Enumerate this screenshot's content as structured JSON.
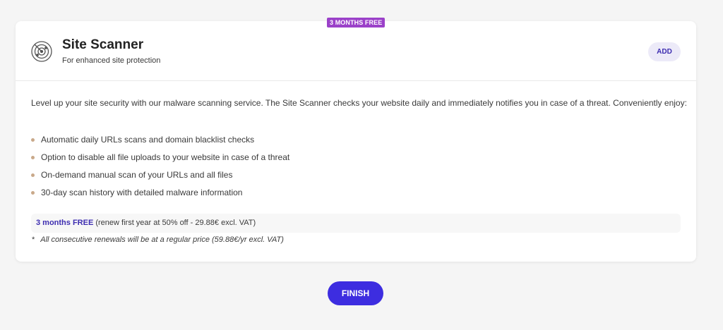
{
  "badge": "3 MONTHS FREE",
  "product": {
    "icon": "radar-icon",
    "title": "Site Scanner",
    "subtitle": "For enhanced site protection",
    "add_label": "ADD"
  },
  "description": "Level up your site security with our malware scanning service. The Site Scanner checks your website daily and immediately notifies you in case of a threat. Conveniently enjoy:",
  "features": [
    "Automatic daily URLs scans and domain blacklist checks",
    "Option to disable all file uploads to your website in case of a threat",
    "On-demand manual scan of your URLs and all files",
    "30-day scan history with detailed malware information"
  ],
  "pricing": {
    "free_label": "3 months FREE",
    "details": " (renew first year at 50% off - 29.88€ excl. VAT)",
    "footnote_mark": "*",
    "footnote": "All consecutive renewals will be at a regular price (59.88€/yr excl. VAT)"
  },
  "finish_label": "FINISH",
  "colors": {
    "accent": "#3d2de0",
    "badge": "#9b41c9",
    "bullet": "#c9a98a"
  }
}
